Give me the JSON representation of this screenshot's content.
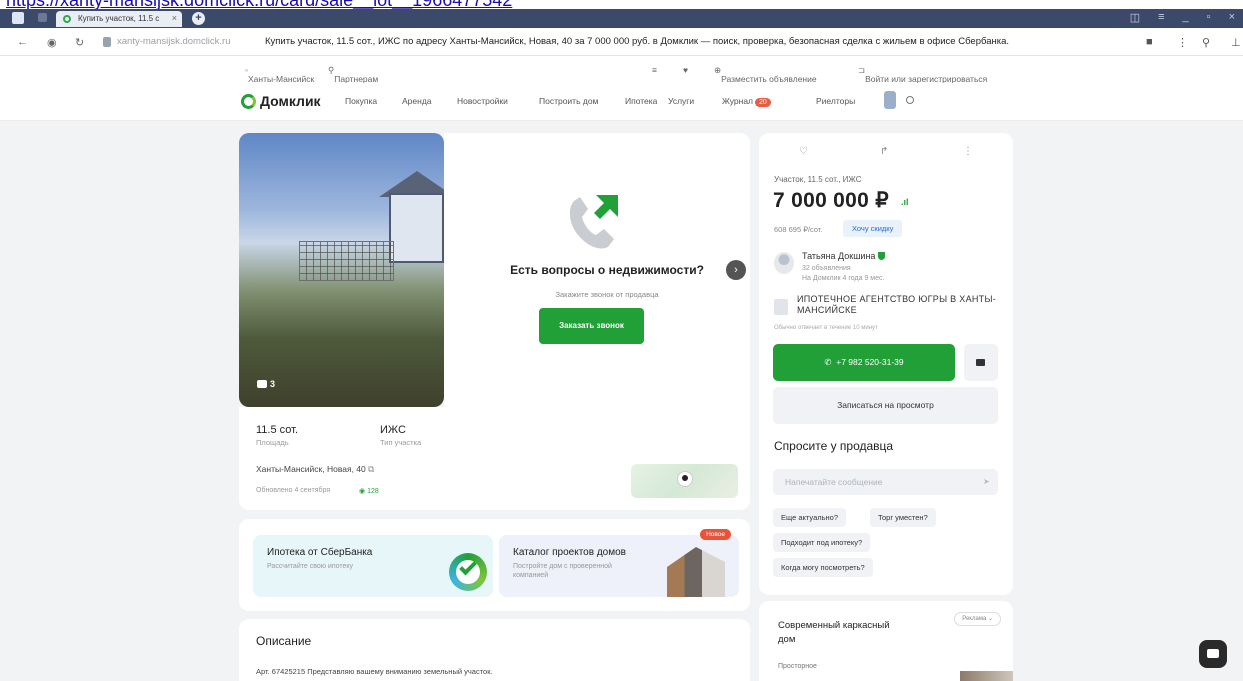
{
  "browser": {
    "url_link": "https://xanty-mansijsk.domclick.ru/card/sale__lot__1966477542",
    "tab_title": "Купить участок, 11.5 с",
    "address_domain": "xanty-mansijsk.domclick.ru",
    "page_title": "Купить участок, 11.5 сот., ИЖС по адресу Ханты-Мансийск, Новая, 40 за 7 000 000 руб. в Домклик — поиск, проверка, безопасная сделка с жильем в офисе Сбербанка."
  },
  "utility_bar": {
    "city": "Ханты-Мансийск",
    "partners": "Партнерам",
    "place_ad": "Разместить объявление",
    "login": "Войти или зарегистрироваться"
  },
  "nav": {
    "logo": "Домклик",
    "items": [
      "Покупка",
      "Аренда",
      "Новостройки",
      "Построить дом",
      "Ипотека",
      "Услуги",
      "Журнал",
      "Риелторы"
    ],
    "journal_badge": "20"
  },
  "listing": {
    "photo_count": "3",
    "questions_title": "Есть вопросы о недвижимости?",
    "questions_sub": "Закажите звонок от продавца",
    "order_call": "Заказать звонок",
    "area_value": "11.5 сот.",
    "area_label": "Площадь",
    "type_value": "ИЖС",
    "type_label": "Тип участка",
    "address": "Ханты-Мансийск, Новая, 40",
    "updated": "Обновлено 4 сентября",
    "views": "128"
  },
  "promos": {
    "mortgage_title": "Ипотека от СберБанка",
    "mortgage_sub": "Рассчитайте свою ипотеку",
    "catalog_title": "Каталог проектов домов",
    "catalog_sub": "Постройте дом с проверенной компанией",
    "new_badge": "Новое"
  },
  "description": {
    "title": "Описание",
    "text": "Арт. 67425215 Представляю вашему вниманию земельный участок."
  },
  "sidebar": {
    "type": "Участок, 11.5 сот., ИЖС",
    "price": "7 000 000 ₽",
    "per_sot": "608 695 ₽/сот.",
    "discount": "Хочу скидку",
    "agent_name": "Татьяна Докшина",
    "agent_ads": "32 объявления",
    "agent_since": "На Домклик 4 года 9 мес.",
    "agency": "ИПОТЕЧНОЕ АГЕНТСТВО ЮГРЫ В ХАНТЫ-МАНСИЙСКЕ",
    "reply_note": "Обычно отвечает в течение 10 минут",
    "phone": "+7 982 520-31-39",
    "schedule_view": "Записаться на просмотр",
    "ask_title": "Спросите у продавца",
    "message_placeholder": "Напечатайте сообщение",
    "chips": [
      "Еще актуально?",
      "Торг уместен?",
      "Подходит под ипотеку?",
      "Когда могу посмотреть?"
    ]
  },
  "ad": {
    "badge": "Реклама",
    "title": "Современный каркасный дом",
    "sub": "Просторное"
  }
}
